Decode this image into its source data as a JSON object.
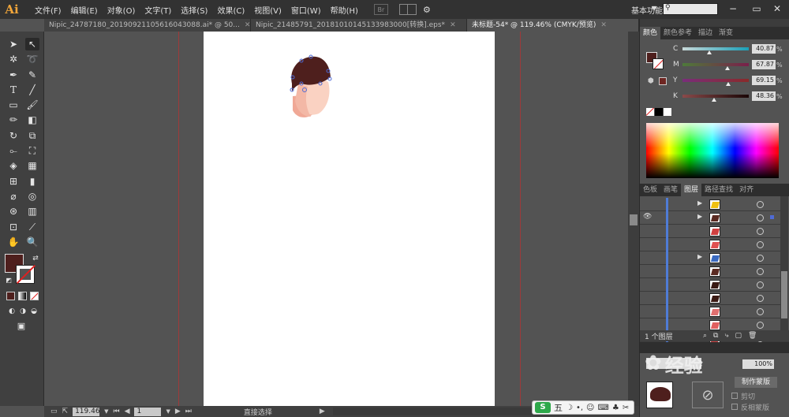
{
  "app": {
    "logo": "Ai"
  },
  "menubar": {
    "items": [
      "文件(F)",
      "编辑(E)",
      "对象(O)",
      "文字(T)",
      "选择(S)",
      "效果(C)",
      "视图(V)",
      "窗口(W)",
      "帮助(H)"
    ],
    "bridge_label": "Br",
    "workspace": "基本功能",
    "search_placeholder": ""
  },
  "tabs": [
    {
      "label": "Nipic_24787180_20190921105616043088.ai* @ 50...",
      "active": false
    },
    {
      "label": "Nipic_21485791_20181010145133983000[转换].eps*",
      "active": false
    },
    {
      "label": "未标题-54* @ 119.46% (CMYK/预览)",
      "active": true
    }
  ],
  "statusbar": {
    "zoom": "119.46",
    "page": "1",
    "tool_name": "直接选择"
  },
  "color_panel": {
    "tabs": [
      "颜色",
      "颜色参考",
      "描边",
      "渐变"
    ],
    "fill_color": "#4e1f1d",
    "channels": [
      {
        "letter": "C",
        "value": "40.87",
        "unit": "%",
        "level": 0.41,
        "gradient": [
          "#c8d8d8",
          "#1aa0b8"
        ]
      },
      {
        "letter": "M",
        "value": "67.87",
        "unit": "%",
        "level": 0.68,
        "gradient": [
          "#4e7a3a",
          "#7a1f4a"
        ]
      },
      {
        "letter": "Y",
        "value": "69.15",
        "unit": "%",
        "level": 0.69,
        "gradient": [
          "#7a2d7a",
          "#8a2a2a"
        ]
      },
      {
        "letter": "K",
        "value": "48.36",
        "unit": "%",
        "level": 0.48,
        "gradient": [
          "#8a4a4a",
          "#1a0606"
        ]
      }
    ]
  },
  "layers_panel": {
    "tabs": [
      "色板",
      "画笔",
      "图层",
      "路径查找",
      "对齐"
    ],
    "count_label": "1 个图层",
    "rows": [
      {
        "thumb": "#f0c010",
        "expand": true,
        "eye": false
      },
      {
        "thumb": "#5a2a22",
        "expand": true,
        "eye": true,
        "selected": true
      },
      {
        "thumb": "#d04040",
        "expand": false,
        "eye": false
      },
      {
        "thumb": "#e05050",
        "expand": false,
        "eye": false
      },
      {
        "thumb": "#3a6ac0",
        "expand": true,
        "eye": false
      },
      {
        "thumb": "#5a2a22",
        "expand": false,
        "eye": false
      },
      {
        "thumb": "#3a1a14",
        "expand": false,
        "eye": false
      },
      {
        "thumb": "#3a1a14",
        "expand": false,
        "eye": false
      },
      {
        "thumb": "#e07070",
        "expand": false,
        "eye": false
      },
      {
        "thumb": "#e06060",
        "expand": false,
        "eye": false
      },
      {
        "thumb": "#d04040",
        "expand": false,
        "eye": false
      }
    ]
  },
  "transparency_panel": {
    "opacity": "100%",
    "make_mask": "制作蒙版",
    "clip": "剪切",
    "invert_mask": "反相蒙版"
  },
  "watermark": {
    "text": "经验"
  },
  "ime": {
    "label": "五"
  }
}
